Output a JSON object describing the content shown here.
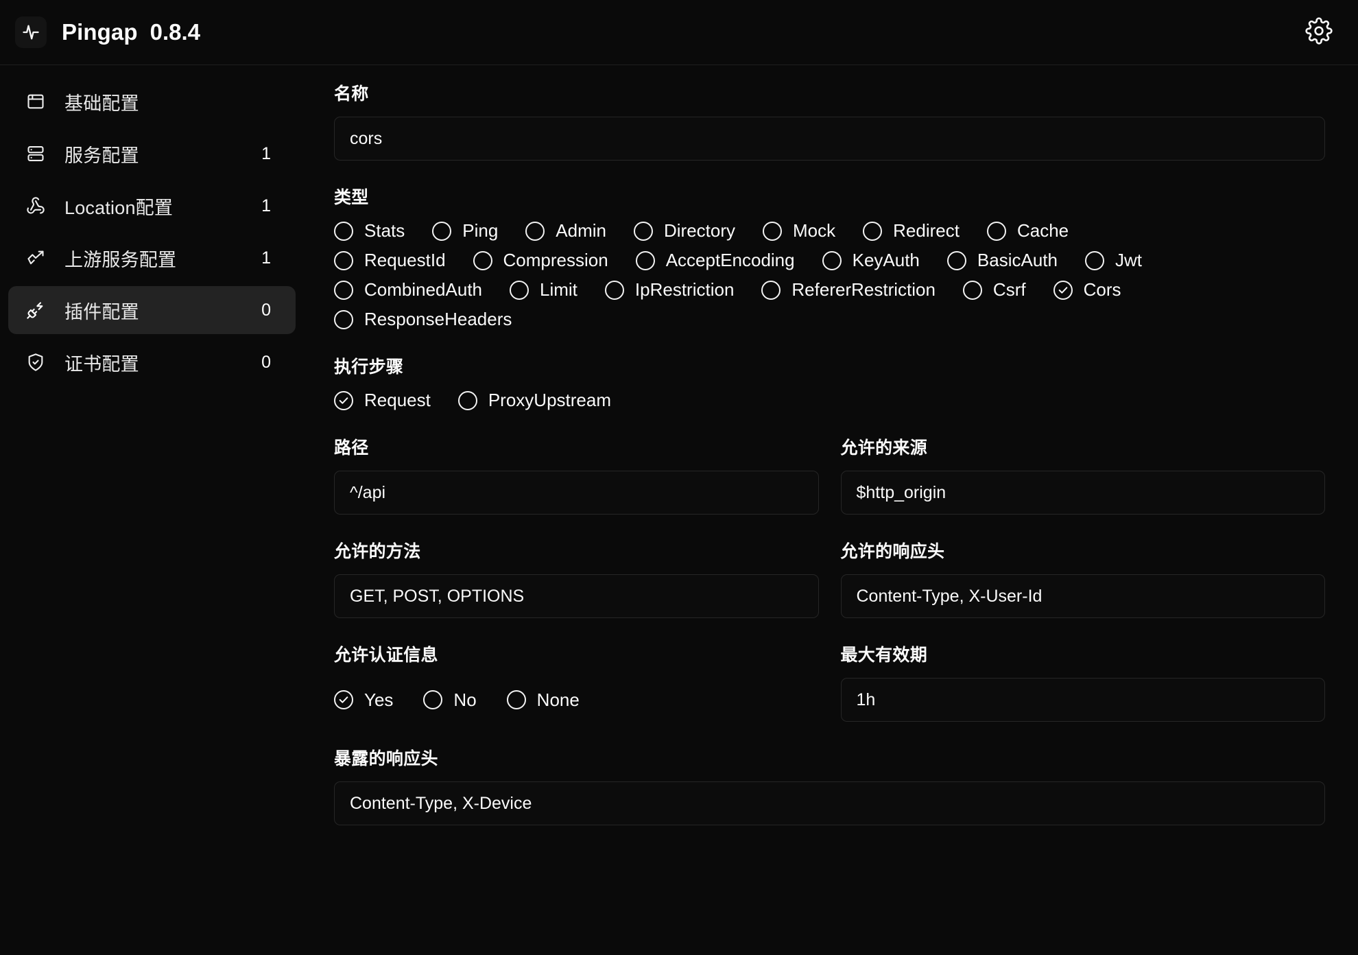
{
  "header": {
    "logo_icon": "activity-pulse-icon",
    "app_name": "Pingap",
    "version": "0.8.4",
    "settings_icon": "gear-icon"
  },
  "sidebar": {
    "items": [
      {
        "label": "基础配置",
        "icon": "window-icon",
        "count": "",
        "active": false
      },
      {
        "label": "服务配置",
        "icon": "server-icon",
        "count": "1",
        "active": false
      },
      {
        "label": "Location配置",
        "icon": "webhook-icon",
        "count": "1",
        "active": false
      },
      {
        "label": "上游服务配置",
        "icon": "trending-up-icon",
        "count": "1",
        "active": false
      },
      {
        "label": "插件配置",
        "icon": "plug-zap-icon",
        "count": "0",
        "active": true
      },
      {
        "label": "证书配置",
        "icon": "shield-check-icon",
        "count": "0",
        "active": false
      }
    ]
  },
  "form": {
    "name": {
      "label": "名称",
      "value": "cors"
    },
    "type": {
      "label": "类型",
      "selected": "Cors",
      "options": [
        [
          "Stats",
          "Ping",
          "Admin",
          "Directory",
          "Mock",
          "Redirect",
          "Cache"
        ],
        [
          "RequestId",
          "Compression",
          "AcceptEncoding",
          "KeyAuth",
          "BasicAuth",
          "Jwt"
        ],
        [
          "CombinedAuth",
          "Limit",
          "IpRestriction",
          "RefererRestriction",
          "Csrf",
          "Cors"
        ],
        [
          "ResponseHeaders"
        ]
      ]
    },
    "step": {
      "label": "执行步骤",
      "selected": "Request",
      "options": [
        "Request",
        "ProxyUpstream"
      ]
    },
    "path": {
      "label": "路径",
      "value": "^/api"
    },
    "allow_origin": {
      "label": "允许的来源",
      "value": "$http_origin"
    },
    "allow_methods": {
      "label": "允许的方法",
      "value": "GET, POST, OPTIONS"
    },
    "allow_headers": {
      "label": "允许的响应头",
      "value": "Content-Type, X-User-Id"
    },
    "allow_credentials": {
      "label": "允许认证信息",
      "selected": "Yes",
      "options": [
        "Yes",
        "No",
        "None"
      ]
    },
    "max_age": {
      "label": "最大有效期",
      "value": "1h"
    },
    "expose_headers": {
      "label": "暴露的响应头",
      "value": "Content-Type, X-Device"
    }
  }
}
